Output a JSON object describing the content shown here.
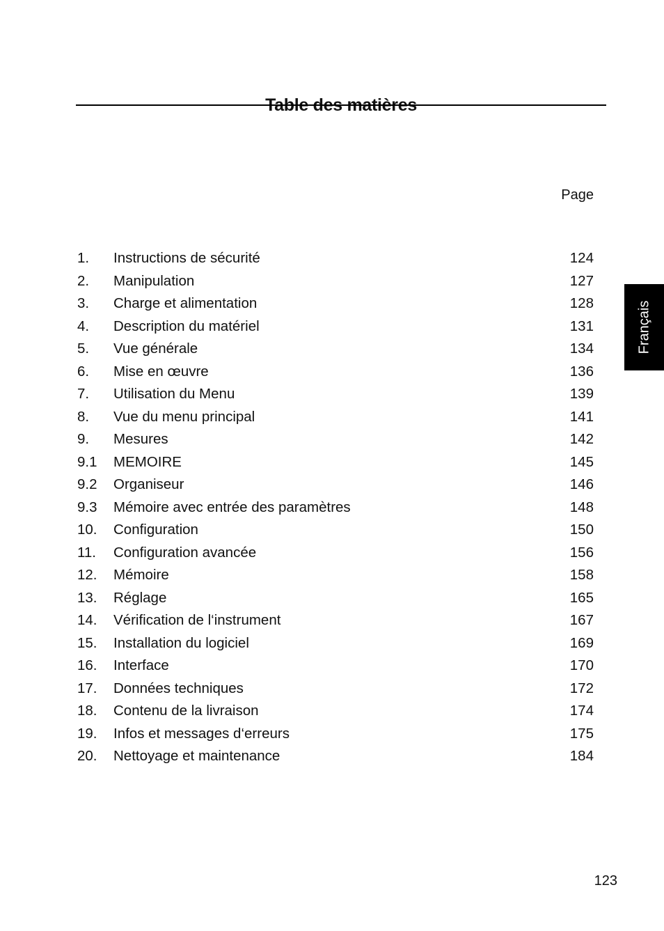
{
  "document": {
    "title": "Table des matières",
    "page_column_header": "Page",
    "language_tab": "Français",
    "page_number": "123"
  },
  "toc": [
    {
      "num": "1.",
      "label": "Instructions de sécurité",
      "page": "124"
    },
    {
      "num": "2.",
      "label": "Manipulation",
      "page": "127"
    },
    {
      "num": "3.",
      "label": "Charge et alimentation",
      "page": "128"
    },
    {
      "num": "4.",
      "label": "Description du matériel",
      "page": "131"
    },
    {
      "num": "5.",
      "label": "Vue générale",
      "page": "134"
    },
    {
      "num": "6.",
      "label": "Mise en œuvre",
      "page": "136"
    },
    {
      "num": "7.",
      "label": "Utilisation du Menu",
      "page": "139"
    },
    {
      "num": "8.",
      "label": "Vue du menu principal",
      "page": "141"
    },
    {
      "num": "9.",
      "label": "Mesures",
      "page": "142"
    },
    {
      "num": "9.1",
      "label": "MEMOIRE",
      "page": "145"
    },
    {
      "num": "9.2",
      "label": "Organiseur",
      "page": "146"
    },
    {
      "num": "9.3",
      "label": "Mémoire avec entrée des paramètres",
      "page": "148"
    },
    {
      "num": "10.",
      "label": "Configuration",
      "page": "150"
    },
    {
      "num": "11.",
      "label": "Configuration avancée",
      "page": "156"
    },
    {
      "num": "12.",
      "label": "Mémoire",
      "page": "158"
    },
    {
      "num": "13.",
      "label": "Réglage",
      "page": "165"
    },
    {
      "num": "14.",
      "label": "Vérification de l‘instrument",
      "page": "167"
    },
    {
      "num": "15.",
      "label": "Installation du logiciel",
      "page": "169"
    },
    {
      "num": "16.",
      "label": "Interface",
      "page": "170"
    },
    {
      "num": "17.",
      "label": "Données techniques",
      "page": "172"
    },
    {
      "num": "18.",
      "label": "Contenu de la livraison",
      "page": "174"
    },
    {
      "num": "19.",
      "label": "Infos et messages d‘erreurs",
      "page": "175"
    },
    {
      "num": "20.",
      "label": "Nettoyage et maintenance",
      "page": "184"
    }
  ]
}
